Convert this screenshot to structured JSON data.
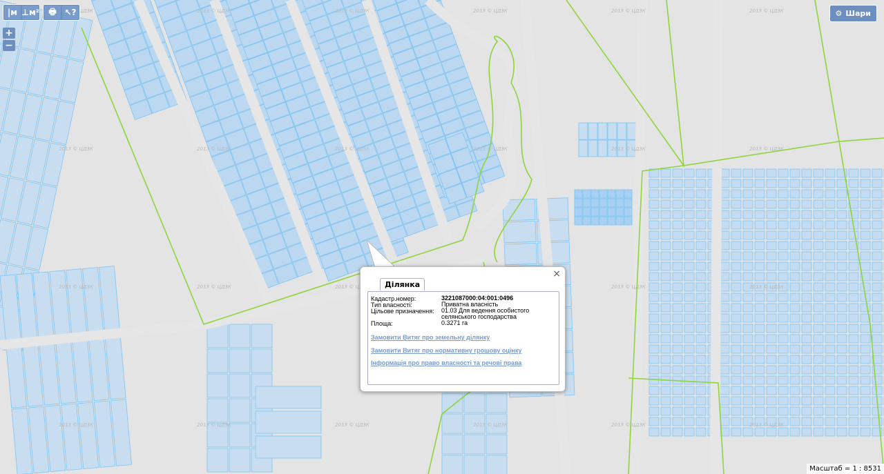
{
  "toolbar": {
    "tools": [
      {
        "label": "|м",
        "icon": "measure-distance-icon"
      },
      {
        "label": "⊥м²",
        "icon": "measure-area-icon"
      },
      {
        "label": "🖶",
        "icon": "print-icon"
      },
      {
        "label": "↖?",
        "icon": "identify-icon"
      }
    ]
  },
  "zoom": {
    "in": "+",
    "out": "−"
  },
  "layers_button": {
    "label": "Шари",
    "icon": "gear-icon"
  },
  "watermark": "2013 © ЦДЗК",
  "scale": {
    "label": "Масштаб = 1 : 8531"
  },
  "popup": {
    "close": "×",
    "tab": "Ділянка",
    "fields": [
      {
        "key": "Кадастр.номер:",
        "value": "3221087000:04:001:0496",
        "bold": true
      },
      {
        "key": "Тип власності:",
        "value": "Приватна власність"
      },
      {
        "key": "Цільове призначення:",
        "value": "01.03 Для ведення особистого селянського господарства"
      },
      {
        "key": "Площа:",
        "value": "0.3271 га"
      }
    ],
    "links": [
      "Замовити Витяг про земельну ділянку",
      "Замовити Витяг про нормативну грошову оцінку",
      "Інформація про право власності та речові права"
    ]
  },
  "colors": {
    "parcel_fill": "#c8def0",
    "parcel_stroke": "#7ec3f2",
    "boundary": "#8fd43c",
    "background": "#e4e4e4"
  }
}
